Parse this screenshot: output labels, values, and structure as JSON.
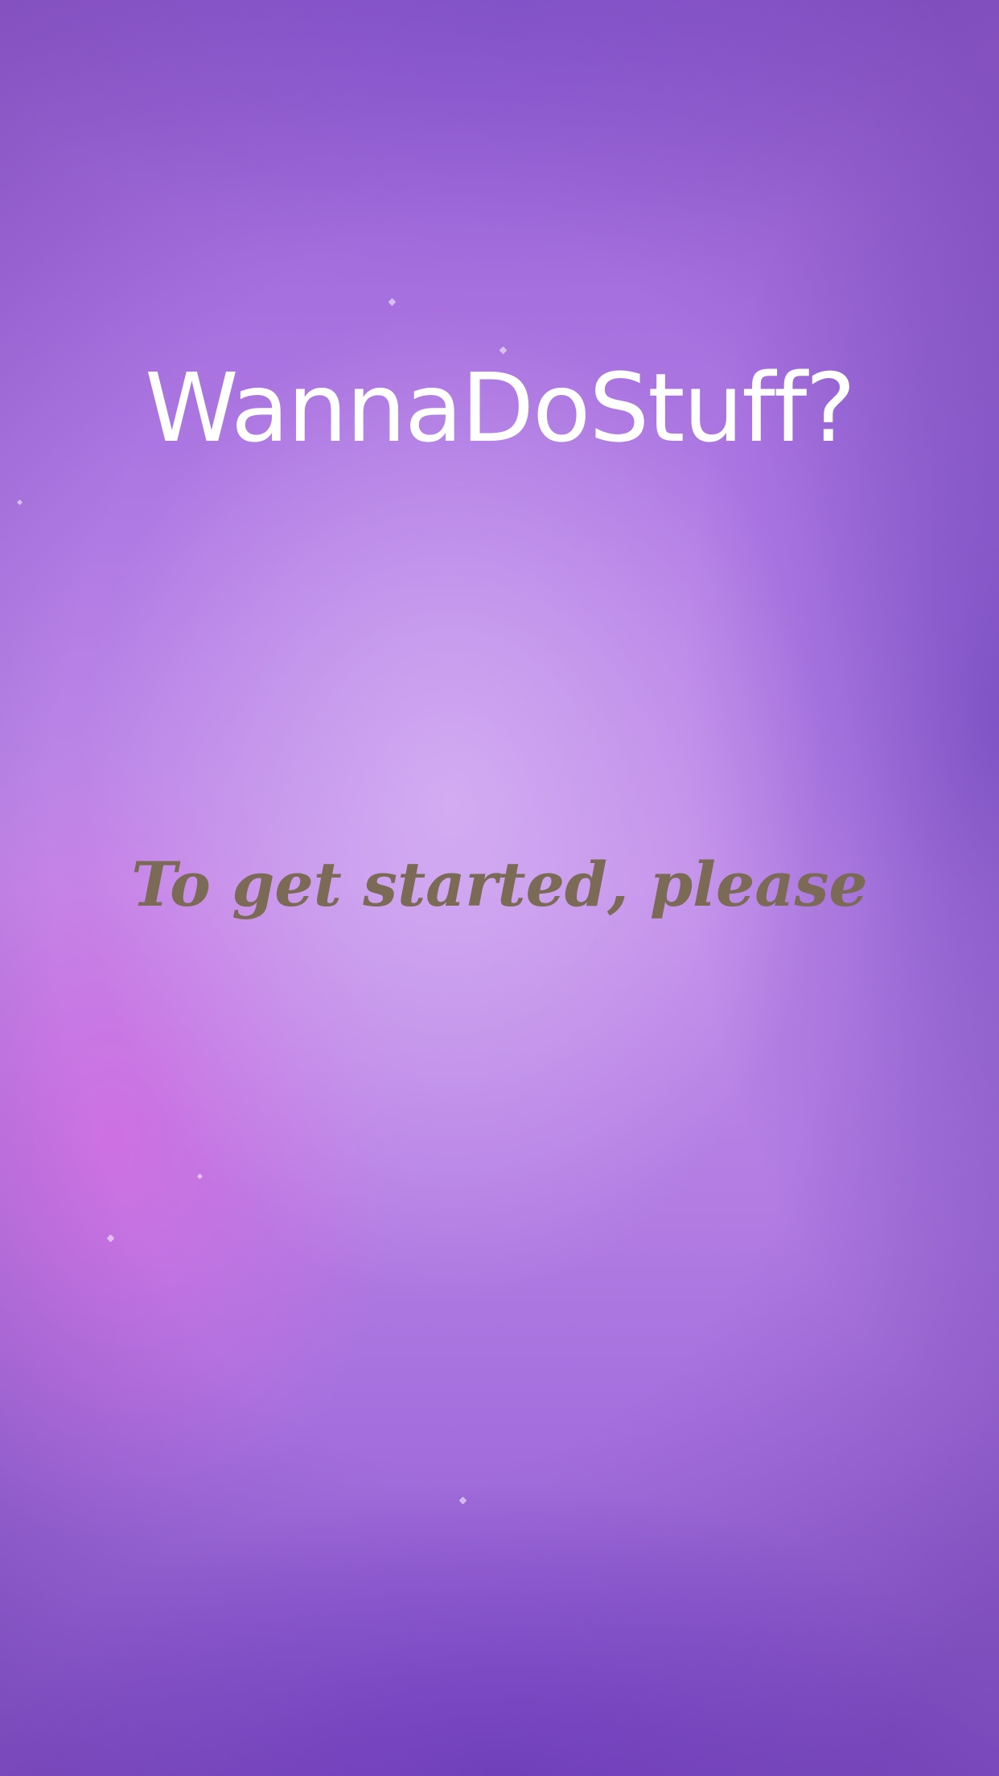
{
  "app": {
    "title": "WannaDoStuff?",
    "prompt": "To get started, please"
  },
  "colors": {
    "background_light": "#c08ae8",
    "background_dark": "#7a4ac8",
    "background_pink": "#d66ce2",
    "title_color": "#ffffff",
    "prompt_color": "#7a6a56"
  }
}
